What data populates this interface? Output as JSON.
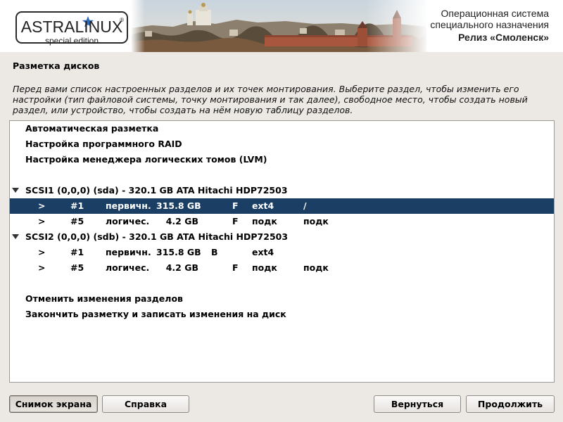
{
  "banner": {
    "logo_text": "ASTRALINUX",
    "logo_sub": "special edition",
    "logo_reg": "®",
    "os_line1": "Операционная система",
    "os_line2": "специального назначения",
    "release": "Релиз «Смоленск»"
  },
  "page": {
    "title": "Разметка дисков",
    "description": "Перед вами список настроенных разделов и их точек монтирования. Выберите раздел, чтобы изменить его настройки (тип файловой системы, точку монтирования и так далее), свободное место, чтобы создать новый раздел, или устройство, чтобы создать на нём новую таблицу разделов."
  },
  "menu_top": [
    "Автоматическая разметка",
    "Настройка программного RAID",
    "Настройка менеджера логических томов (LVM)"
  ],
  "disks": [
    {
      "label": "SCSI1 (0,0,0) (sda) - 320.1 GB ATA Hitachi HDP72503",
      "partitions": [
        {
          "arrow": ">",
          "num": "#1",
          "type": "первичн.",
          "size": "315.8 GB",
          "flag1": "",
          "flag2": "F",
          "fs": "ext4",
          "mount": "/",
          "selected": true
        },
        {
          "arrow": ">",
          "num": "#5",
          "type": "логичес.",
          "size": "4.2 GB",
          "flag1": "",
          "flag2": "F",
          "fs": "подк",
          "mount": "подк",
          "selected": false
        }
      ]
    },
    {
      "label": "SCSI2 (0,0,0) (sdb) - 320.1 GB ATA Hitachi HDP72503",
      "partitions": [
        {
          "arrow": ">",
          "num": "#1",
          "type": "первичн.",
          "size": "315.8 GB",
          "flag1": "B",
          "flag2": "",
          "fs": "ext4",
          "mount": "",
          "selected": false
        },
        {
          "arrow": ">",
          "num": "#5",
          "type": "логичес.",
          "size": "4.2 GB",
          "flag1": "",
          "flag2": "F",
          "fs": "подк",
          "mount": "подк",
          "selected": false
        }
      ]
    }
  ],
  "menu_bottom": [
    "Отменить изменения разделов",
    "Закончить разметку и записать изменения на диск"
  ],
  "buttons": {
    "screenshot": "Снимок экрана",
    "help": "Справка",
    "back": "Вернуться",
    "continue": "Продолжить"
  },
  "colors": {
    "selection": "#1b3e64",
    "background": "#ece9e5",
    "logo_star": "#2f6bb5"
  }
}
